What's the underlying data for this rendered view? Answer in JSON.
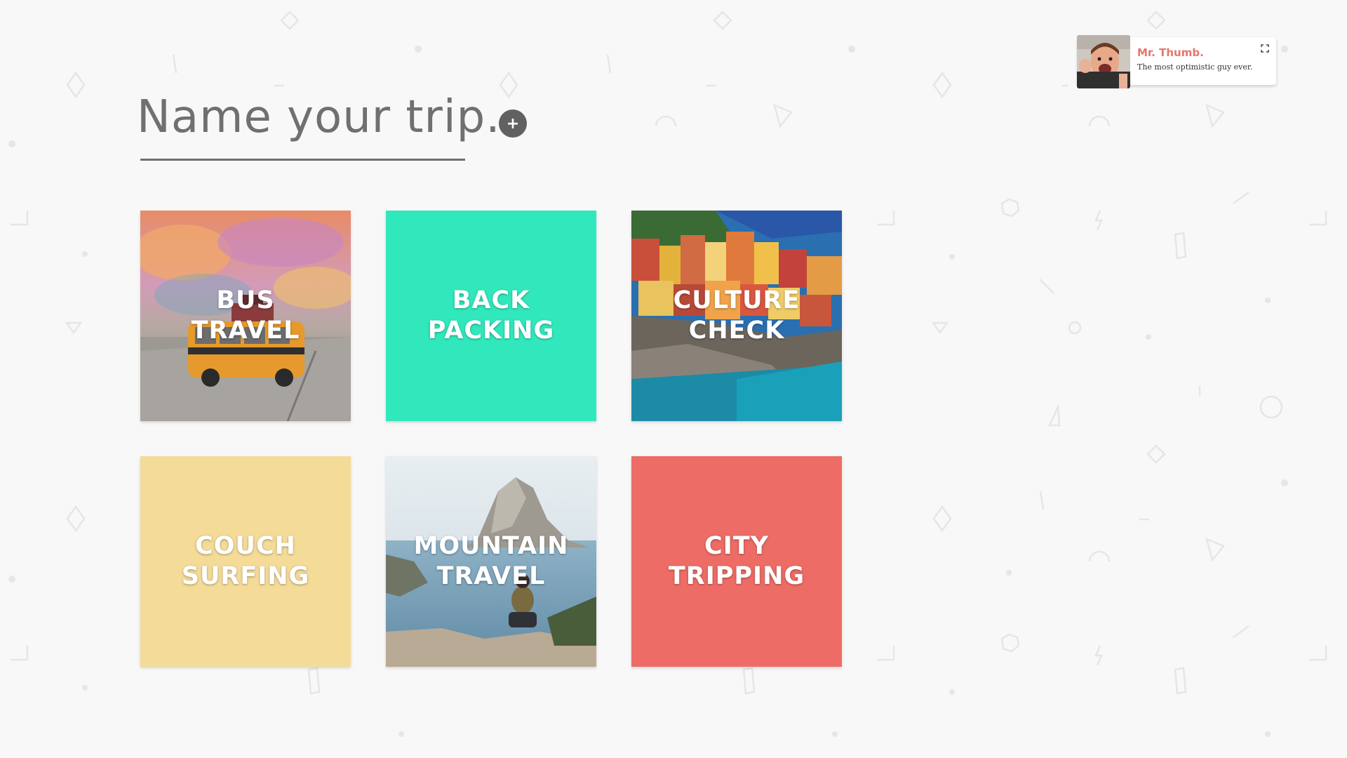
{
  "header": {
    "title": "Name your trip.",
    "add_button_label": "+"
  },
  "profile": {
    "name": "Mr. Thumb.",
    "tagline": "The most optimistic guy ever."
  },
  "tiles": [
    {
      "line1": "BUS",
      "line2": "TRAVEL",
      "color": "#d9b06a"
    },
    {
      "line1": "BACK",
      "line2": "PACKING",
      "color": "#31e8bd"
    },
    {
      "line1": "CULTURE",
      "line2": "CHECK",
      "color": "#c98a4a"
    },
    {
      "line1": "COUCH",
      "line2": "SURFING",
      "color": "#f4db98"
    },
    {
      "line1": "MOUNTAIN",
      "line2": "TRAVEL",
      "color": "#8fb2c6"
    },
    {
      "line1": "CITY",
      "line2": "TRIPPING",
      "color": "#ee6c66"
    }
  ],
  "colors": {
    "background": "#f8f8f8",
    "title_text": "#707070",
    "accent_name": "#e8756b"
  },
  "icons": [
    "plus-icon",
    "expand-icon"
  ]
}
